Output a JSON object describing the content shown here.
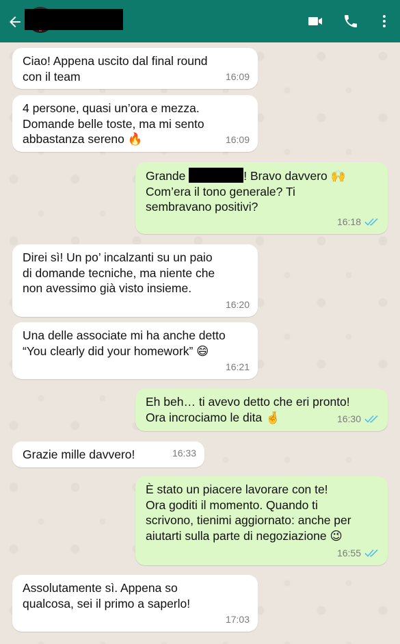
{
  "header": {
    "icons": [
      "back-arrow-icon",
      "video-call-icon",
      "phone-icon",
      "more-vertical-icon"
    ],
    "colors": {
      "bar": "#0e7a6b",
      "icon": "#ffffff"
    }
  },
  "colors": {
    "incoming_bubble": "#ffffff",
    "outgoing_bubble": "#dcf8c6",
    "read_ticks": "#53bdeb",
    "chat_background": "#ece5dd"
  },
  "messages": [
    {
      "direction": "in",
      "text": "Ciao! Appena uscito dal final round\ncon il team",
      "time": "16:09"
    },
    {
      "direction": "in",
      "text": "4 persone, quasi un’ora e mezza.\nDomande belle toste, ma mi sento\nabbastanza sereno 🔥",
      "time": "16:09"
    },
    {
      "direction": "out",
      "text_before": "Grande ",
      "text_after": "! Bravo davvero 🙌\nCom’era il tono generale? Ti\nsembravano positivi?",
      "time": "16:18",
      "status": "read"
    },
    {
      "direction": "in",
      "text": "Direi sì! Un po’ incalzanti su un paio\ndi domande tecniche, ma niente che\nnon avessimo già visto insieme.",
      "time": "16:20"
    },
    {
      "direction": "in",
      "text": "Una delle associate mi ha anche detto\n“You clearly did your homework” 😄",
      "time": "16:21"
    },
    {
      "direction": "out",
      "text": "Eh beh… ti avevo detto che eri pronto!\nOra incrociamo le dita 🤞",
      "time": "16:30",
      "status": "read"
    },
    {
      "direction": "in",
      "text": "Grazie mille davvero!",
      "time": "16:33"
    },
    {
      "direction": "out",
      "text": "È stato un piacere lavorare con te!\nOra goditi il momento. Quando ti\nscrivono, tienimi aggiornato: anche per\naiutarti sulla parte di negoziazione 😉",
      "time": "16:55",
      "status": "read"
    },
    {
      "direction": "in",
      "text": "Assolutamente sì. Appena so\nqualcosa, sei il primo a saperlo!",
      "time": "17:03"
    }
  ]
}
